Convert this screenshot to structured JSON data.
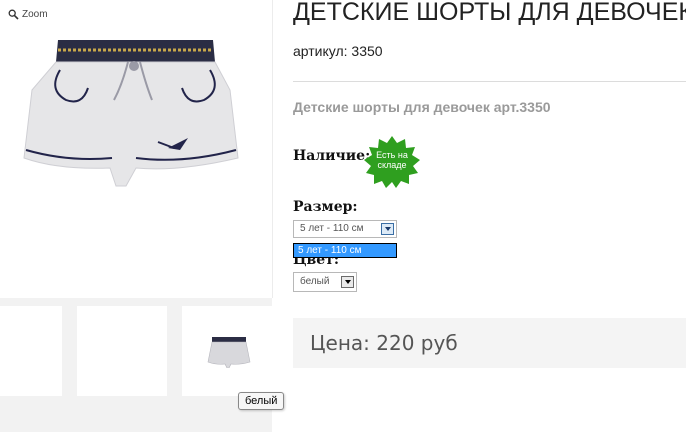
{
  "gallery": {
    "zoom_label": "Zoom",
    "tooltip": "белый"
  },
  "product": {
    "title": "ДЕТСКИЕ ШОРТЫ ДЛЯ ДЕВОЧЕК",
    "article": "артикул: 3350",
    "description": "Детские шорты для девочек арт.3350",
    "availability_label": "Наличие:",
    "availability_badge": [
      "Есть на",
      "складе"
    ],
    "size_label": "Размер:",
    "size_selected": "5 лет - 110 см",
    "size_options": [
      "5 лет - 110 см"
    ],
    "color_label": "Цвет:",
    "color_selected": "белый",
    "price_label": "Цена: 220 руб"
  },
  "colors": {
    "badge_green": "#2f9f1f",
    "dropdown_highlight": "#3399ff",
    "price_bg": "#f4f4f4"
  }
}
